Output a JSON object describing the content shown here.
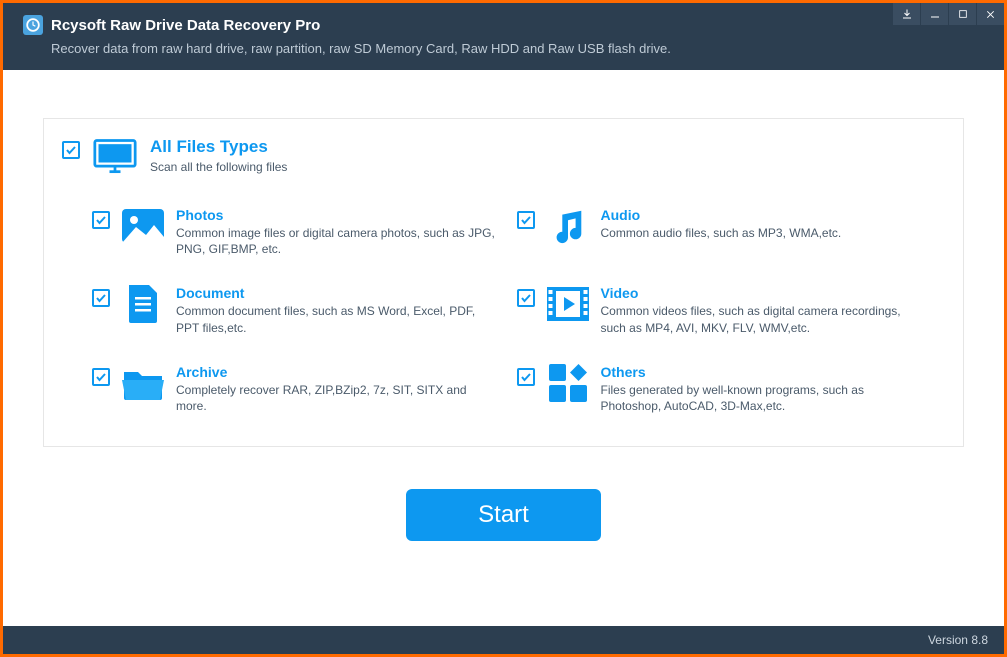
{
  "header": {
    "title": "Rcysoft Raw Drive Data Recovery Pro",
    "subtitle": "Recover data from raw hard drive, raw partition, raw SD Memory Card, Raw HDD and Raw USB flash drive."
  },
  "master": {
    "title": "All Files Types",
    "desc": "Scan all the following files"
  },
  "categories": {
    "photos": {
      "title": "Photos",
      "desc": "Common image files or digital camera photos, such as JPG, PNG, GIF,BMP, etc."
    },
    "audio": {
      "title": "Audio",
      "desc": "Common audio files, such as MP3, WMA,etc."
    },
    "document": {
      "title": "Document",
      "desc": "Common document files, such as MS Word, Excel, PDF, PPT files,etc."
    },
    "video": {
      "title": "Video",
      "desc": "Common videos files, such as digital camera recordings, such as MP4, AVI, MKV, FLV, WMV,etc."
    },
    "archive": {
      "title": "Archive",
      "desc": "Completely recover RAR, ZIP,BZip2, 7z, SIT, SITX and more."
    },
    "others": {
      "title": "Others",
      "desc": "Files generated by well-known programs, such as Photoshop, AutoCAD, 3D-Max,etc."
    }
  },
  "start_label": "Start",
  "footer": {
    "version": "Version 8.8"
  }
}
